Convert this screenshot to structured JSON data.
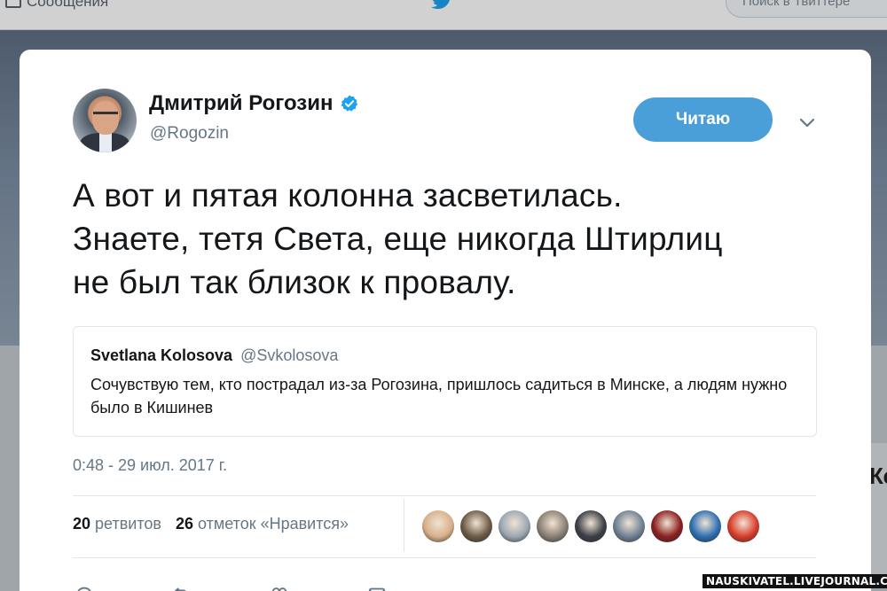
{
  "background": {
    "messages_label": "Сообщения",
    "search_placeholder": "Поиск в Твиттере"
  },
  "tweet": {
    "author_name": "Дмитрий Рогозин",
    "author_handle": "@Rogozin",
    "follow_label": "Читаю",
    "text_lines": [
      "А вот и пятая колонна засветилась.",
      "Знаете, тетя Света, еще никогда Штирлиц",
      "не был так близок к провалу."
    ],
    "timestamp": "0:48 - 29 июл. 2017 г.",
    "retweets_count": "20",
    "retweets_label": "ретвитов",
    "likes_count": "26",
    "likes_label": "отметок «Нравится»"
  },
  "quote": {
    "name": "Svetlana Kolosova",
    "handle": "@Svkolosova",
    "text": "Сочувствую тем, кто пострадал из-за Рогозина, пришлось садиться в Минске, а людям нужно было в Кишинев"
  },
  "likers": [
    {
      "color": "#d8b08a"
    },
    {
      "color": "#6b5a45"
    },
    {
      "color": "#9aa7b3"
    },
    {
      "color": "#8a7f74"
    },
    {
      "color": "#3b3f46"
    },
    {
      "color": "#6f8194"
    },
    {
      "color": "#8a1f1f"
    },
    {
      "color": "#2d6fb0"
    },
    {
      "color": "#d83b2a"
    }
  ],
  "colors": {
    "accent": "#4a9fd8",
    "verified": "#1da1f2",
    "text": "#14171a",
    "muted": "#657786"
  },
  "right_partial_text": "Кс",
  "watermark": "NAUSKIVATEL.LIVEJOURNAL.COM"
}
